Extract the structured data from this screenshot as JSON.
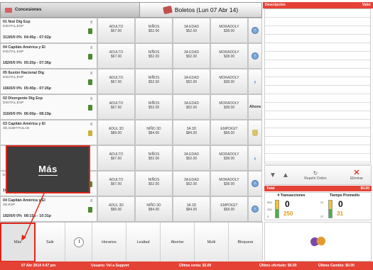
{
  "tabs": {
    "concesiones": "Concesiones",
    "boletos": "Boletos (Lun 07 Abr 14)"
  },
  "sessions": [
    {
      "title": "01 Noé Dig Esp",
      "format": "DIGITAL,ESP",
      "stats": "313/0/0  0%",
      "time": "04:45p - 07:02p",
      "num": "8"
    },
    {
      "title": "04 Capitán América y El",
      "format": "DIGITAL,ESP",
      "stats": "182/0/0  0%",
      "time": "05:20p - 07:36p",
      "num": "8"
    },
    {
      "title": "05 Ilusión Nacional Dig",
      "format": "DIGITAL,ESP",
      "stats": "166/0/0  0%",
      "time": "05:40p - 07:26p",
      "num": "8"
    },
    {
      "title": "02 Divergente Dig Esp",
      "format": "DIGITAL,ESP",
      "stats": "316/0/0  0%",
      "time": "06:00p - 08:19p",
      "num": "8"
    },
    {
      "title": "03 Capitán América y El",
      "format": "3D,SUBTITULAD",
      "stats": "",
      "time": "",
      "num": "8"
    },
    {
      "title": "",
      "format": "",
      "stats": "",
      "time": "",
      "num": ""
    },
    {
      "title": "",
      "format": "DIGITAL,ESP",
      "stats": "166/0/0  0%",
      "time": "07:50p - 09:36p",
      "num": ""
    },
    {
      "title": "04 Capitán América y El",
      "format": "3D,ESP",
      "stats": "182/0/0  0%",
      "time": "08:15p - 10:31p",
      "num": "8"
    }
  ],
  "rows": [
    {
      "cells": [
        "ADULTO\n$67.00",
        "NIÑOS\n$52.00",
        "3A EDAD\n$52.00",
        "MORADOLY\n$38.00"
      ],
      "action": "circle"
    },
    {
      "cells": [
        "ADULTO\n$67.00",
        "NIÑOS\n$52.00",
        "3A EDAD\n$52.00",
        "MORADOLY\n$38.00"
      ],
      "action": "circle"
    },
    {
      "cells": [
        "ADULTO\n$67.00",
        "NIÑOS\n$52.00",
        "3A EDAD\n$52.00",
        "MORADOLY\n$38.00"
      ],
      "action": "arrow"
    },
    {
      "cells": [
        "ADULTO\n$67.00",
        "NIÑOS\n$52.00",
        "3A EDAD\n$52.00",
        "MORADOLY\n$38.00"
      ],
      "action": "ahora"
    },
    {
      "cells": [
        "ADUL 3D\n$89.00",
        "NIÑO 3D\n$84.00",
        "3A 3D\n$84.00",
        "EMPDIGIT\n$68.00"
      ],
      "action": "pop"
    },
    {
      "cells": [
        "ADULTO\n$67.00",
        "NIÑOS\n$52.00",
        "3A EDAD\n$52.00",
        "MORADOLY\n$38.00"
      ],
      "action": "arrow"
    },
    {
      "cells": [
        "ADULTO\n$67.00",
        "NIÑOS\n$52.00",
        "3A EDAD\n$52.00",
        "MORADOLY\n$38.00"
      ],
      "action": "circle"
    },
    {
      "cells": [
        "ADUL 3D\n$89.00",
        "NIÑO 3D\n$84.00",
        "3A 3D\n$84.00",
        "EMPDIGIT\n$68.00"
      ],
      "action": "circle"
    }
  ],
  "ahora_label": "Ahora",
  "right": {
    "desc_header": "Descripción",
    "valor_header": "Valor",
    "repetir": "Repetir Orden",
    "eliminar": "Eliminar",
    "total_label": "Total",
    "total_value": "$0.00",
    "transacciones": {
      "title": "# Transacciones",
      "value": "0",
      "limit": "250",
      "ticks": [
        "500",
        "250",
        "0"
      ]
    },
    "tiempo": {
      "title": "Tiempo Promedio",
      "value": "0",
      "limit": "31",
      "ticks": [
        "31",
        "37"
      ]
    }
  },
  "toolbar": [
    "Más",
    "Salir",
    "",
    "Horarios",
    "Lealtad",
    "Abortar",
    "Multi",
    "Bloquear"
  ],
  "status": {
    "date": "07 Abr 2014 4:47 pm",
    "user": "Usuario: Vel a Support",
    "venta": "Última venta: $0.00",
    "ofertado": "Último ofertado: $0.00",
    "cambio": "Último Cambio: $0.00"
  },
  "callout_label": "Más",
  "colors": {
    "accent": "#e54236",
    "highlight": "#e0261b"
  }
}
